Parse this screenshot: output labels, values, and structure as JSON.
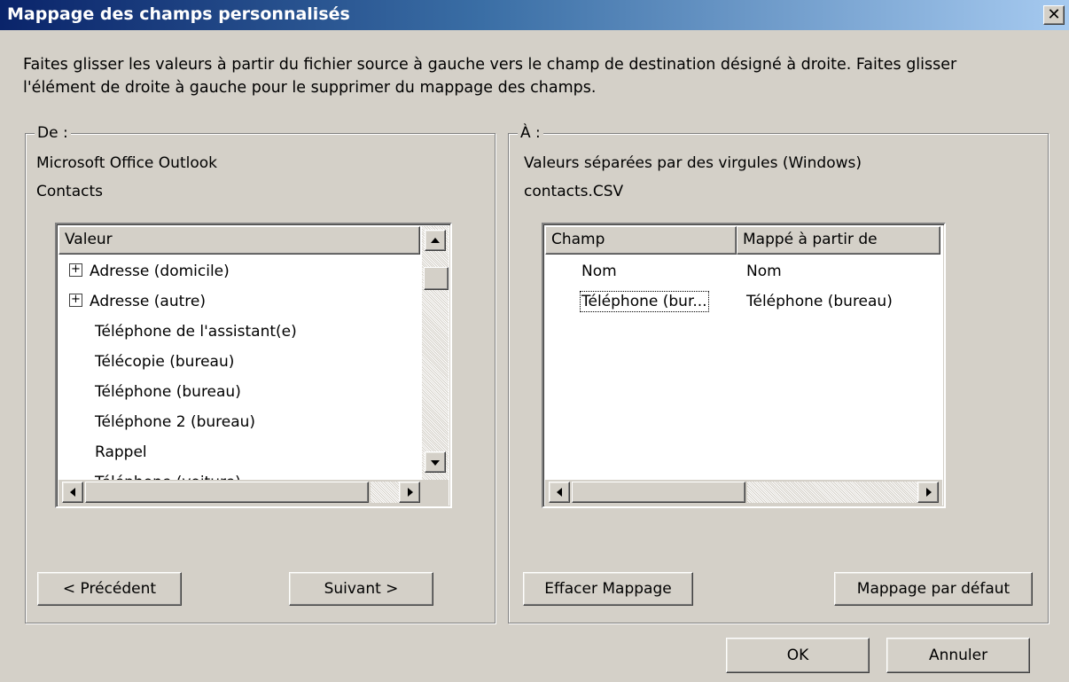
{
  "window": {
    "title": "Mappage des champs personnalisés",
    "close_symbol": "✕"
  },
  "instructions": {
    "line1": "Faites glisser les valeurs à partir du fichier source à gauche vers le champ de destination désigné à droite. Faites glisser",
    "line2": "l'élément de droite à gauche pour le supprimer du mappage des champs."
  },
  "from": {
    "legend": "De :",
    "app": "Microsoft Office Outlook",
    "folder": "Contacts",
    "column_header": "Valeur",
    "items": [
      {
        "label": "Adresse (domicile)",
        "expandable": true,
        "expand_symbol": "+"
      },
      {
        "label": "Adresse (autre)",
        "expandable": true,
        "expand_symbol": "+"
      },
      {
        "label": "Téléphone de l'assistant(e)",
        "expandable": false
      },
      {
        "label": "Télécopie (bureau)",
        "expandable": false
      },
      {
        "label": "Téléphone (bureau)",
        "expandable": false
      },
      {
        "label": "Téléphone 2 (bureau)",
        "expandable": false
      },
      {
        "label": "Rappel",
        "expandable": false
      },
      {
        "label": "Téléphone (voiture)",
        "expandable": false
      }
    ],
    "prev_button": "< Précédent",
    "next_button": "Suivant >"
  },
  "to": {
    "legend": "À :",
    "format": "Valeurs séparées par des virgules (Windows)",
    "file": "contacts.CSV",
    "column_headers": [
      "Champ",
      "Mappé à partir de"
    ],
    "rows": [
      {
        "field": "Nom",
        "mapped_from": "Nom"
      },
      {
        "field": "Téléphone (bur...",
        "mapped_from": "Téléphone (bureau)"
      }
    ],
    "clear_button": "Effacer Mappage",
    "default_button": "Mappage par défaut"
  },
  "footer": {
    "ok_button": "OK",
    "cancel_button": "Annuler"
  }
}
